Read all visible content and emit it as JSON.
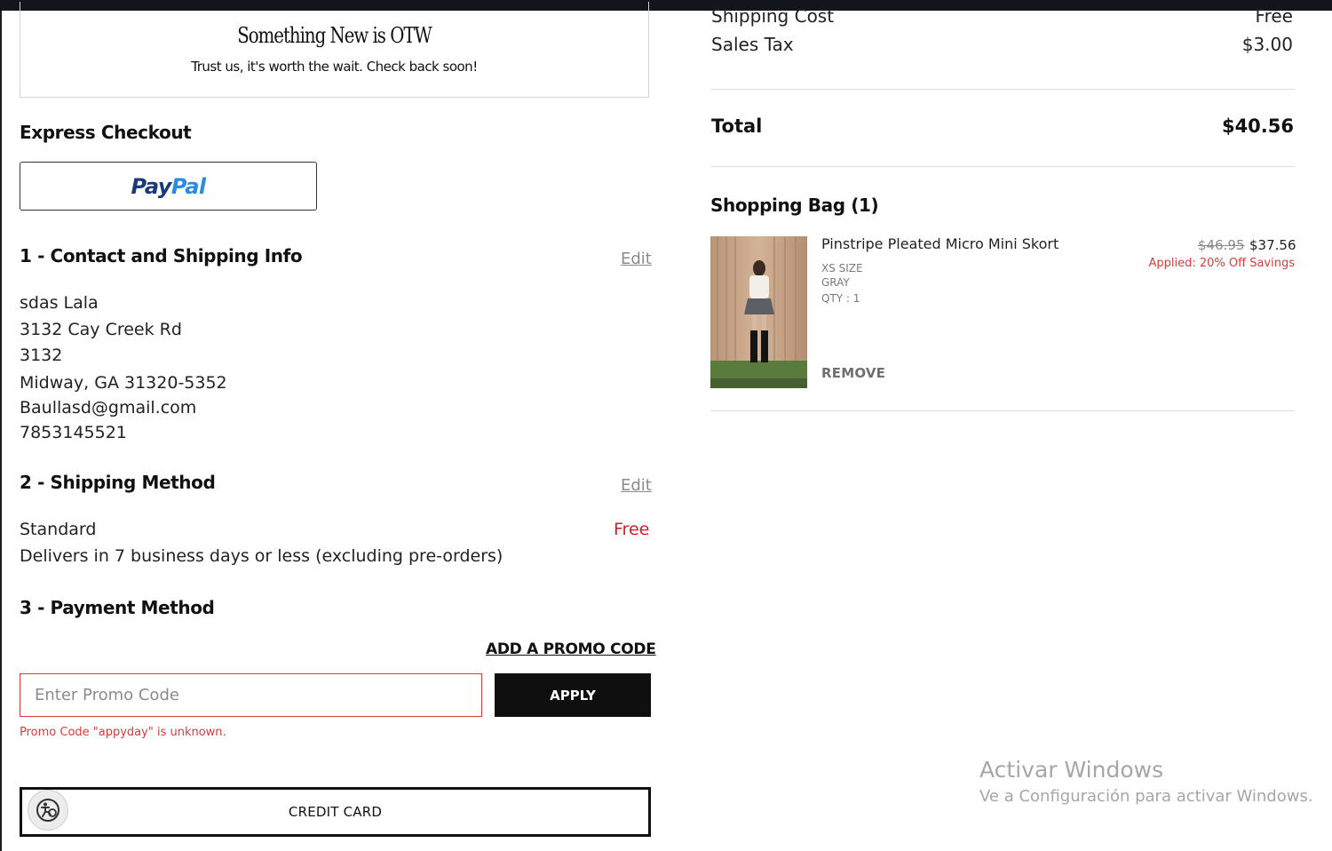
{
  "banner": {
    "title": "Something New is OTW",
    "subtitle": "Trust us, it's worth the wait. Check back soon!"
  },
  "express_checkout": {
    "heading": "Express Checkout",
    "paypal_text_1": "Pay",
    "paypal_text_2": "Pal"
  },
  "contact": {
    "heading": "1 - Contact and Shipping Info",
    "edit_label": "Edit",
    "lines": [
      "sdas Lala",
      "3132 Cay Creek Rd",
      "3132",
      "Midway, GA 31320-5352",
      "Baullasd@gmail.com",
      "7853145521"
    ]
  },
  "shipping_method": {
    "heading": "2 - Shipping Method",
    "edit_label": "Edit",
    "name": "Standard",
    "price": "Free",
    "description": "Delivers in 7 business days or less (excluding pre-orders)"
  },
  "payment": {
    "heading": "3 - Payment Method",
    "add_promo_label": "ADD A PROMO CODE",
    "promo_placeholder": "Enter Promo Code",
    "promo_value": "",
    "apply_label": "APPLY",
    "promo_error": "Promo Code \"appyday\" is unknown.",
    "credit_card_label": "CREDIT CARD"
  },
  "summary": {
    "shipping_cost_label": "Shipping Cost",
    "shipping_cost_value": "Free",
    "sales_tax_label": "Sales Tax",
    "sales_tax_value": "$3.00",
    "total_label": "Total",
    "total_value": "$40.56"
  },
  "bag": {
    "heading": "Shopping Bag (1)",
    "item": {
      "name": "Pinstripe Pleated Micro Mini Skort",
      "size": "XS SIZE",
      "color": "GRAY",
      "qty": "QTY : 1",
      "original_price": "$46.95",
      "sale_price": "$37.56",
      "savings": "Applied: 20% Off Savings",
      "remove_label": "REMOVE"
    }
  },
  "os_watermark": {
    "title": "Activar Windows",
    "subtitle": "Ve a Configuración para activar Windows."
  },
  "icons": {
    "accessibility": "accessibility-icon"
  },
  "colors": {
    "accent_red": "#d83c3c",
    "free_red": "#d21d2a",
    "paypal_dark": "#1b3a7a",
    "paypal_light": "#2a8ce0",
    "button_black": "#0f0f0f"
  }
}
